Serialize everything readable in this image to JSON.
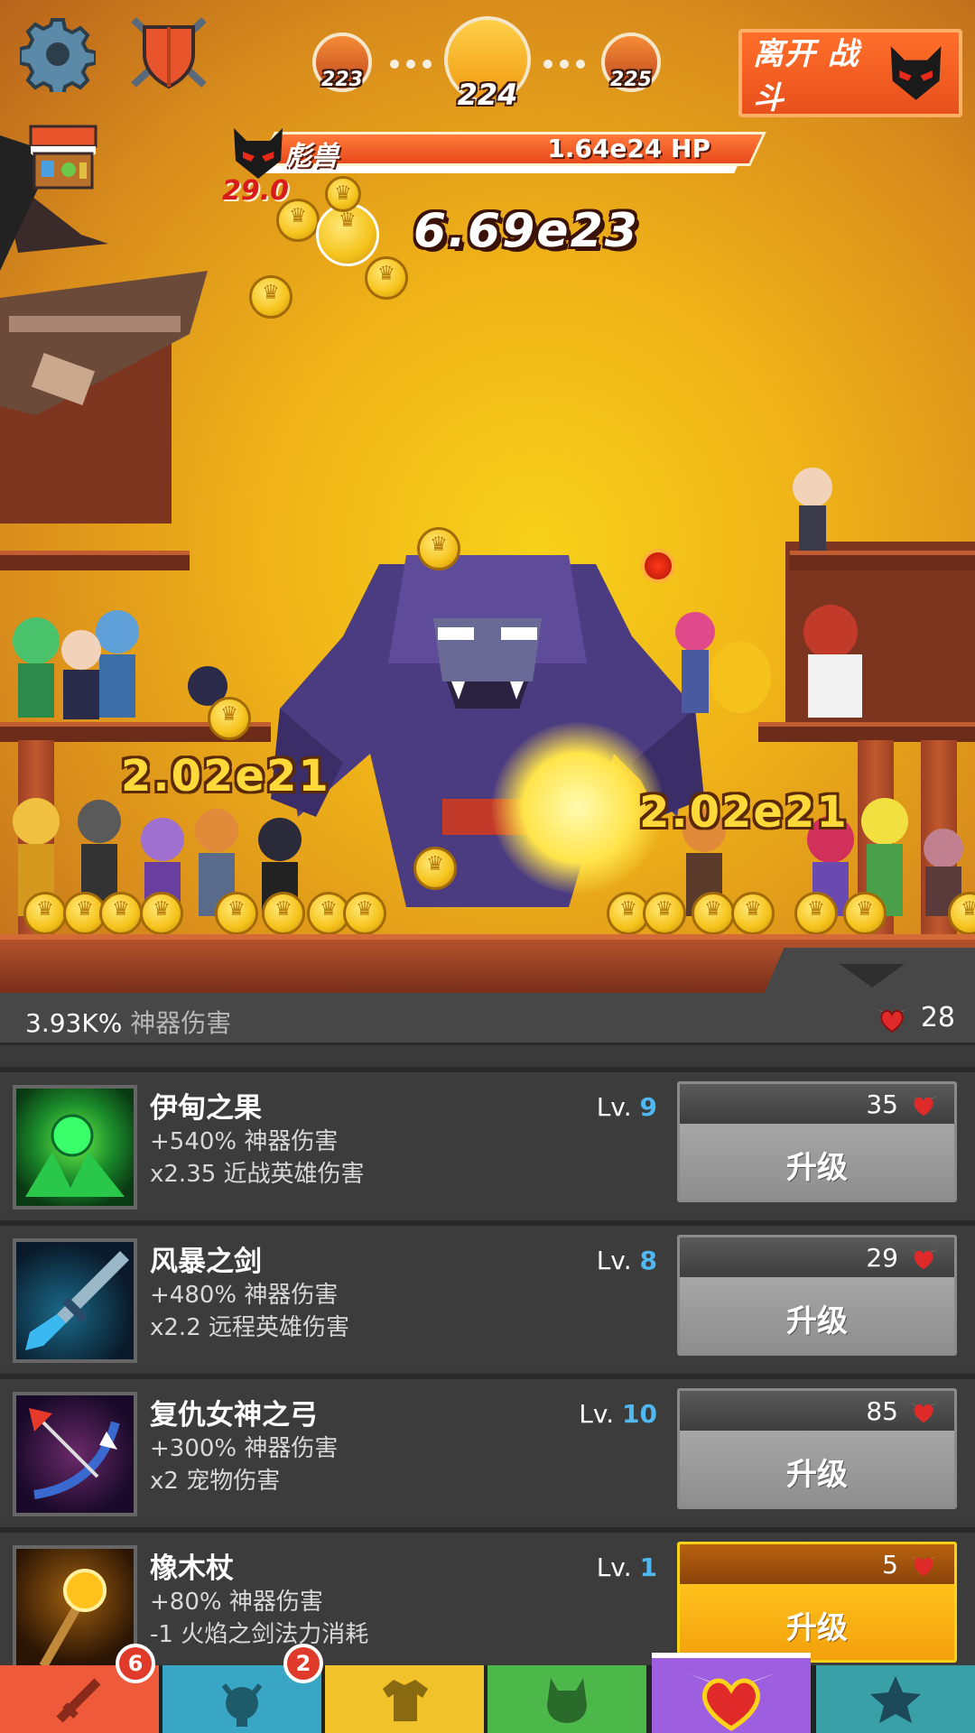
{
  "top": {
    "leave_label": "离开 战斗",
    "stages": {
      "prev": "223",
      "current": "224",
      "next": "225"
    }
  },
  "boss": {
    "name": "彪兽",
    "hp": "1.64e24 HP",
    "timer": "29.0",
    "damage": "6.69e23"
  },
  "hits": {
    "left": "2.02e21",
    "right": "2.02e21"
  },
  "panel": {
    "total_value": "3.93K%",
    "total_label": "神器伤害",
    "relic_count": "28",
    "upgrade_label": "升级",
    "lv_prefix": "Lv.",
    "artifacts": [
      {
        "name": "伊甸之果",
        "line1": "+540% 神器伤害",
        "line2": "x2.35 近战英雄伤害",
        "level": "9",
        "cost": "35"
      },
      {
        "name": "风暴之剑",
        "line1": "+480% 神器伤害",
        "line2": "x2.2 远程英雄伤害",
        "level": "8",
        "cost": "29"
      },
      {
        "name": "复仇女神之弓",
        "line1": "+300% 神器伤害",
        "line2": "x2 宠物伤害",
        "level": "10",
        "cost": "85"
      },
      {
        "name": "橡木杖",
        "line1": "+80% 神器伤害",
        "line2": "-1 火焰之剑法力消耗",
        "level": "1",
        "cost": "5"
      }
    ]
  },
  "nav": {
    "badges": {
      "weapons": "6",
      "heroes": "2"
    },
    "colors": {
      "weapons": "#ef5a3a",
      "heroes": "#38a6c4",
      "equipment": "#f2c22a",
      "pets": "#4cb84a",
      "artifacts": "#9d5fe0",
      "achievements": "#3aa0a8"
    }
  }
}
